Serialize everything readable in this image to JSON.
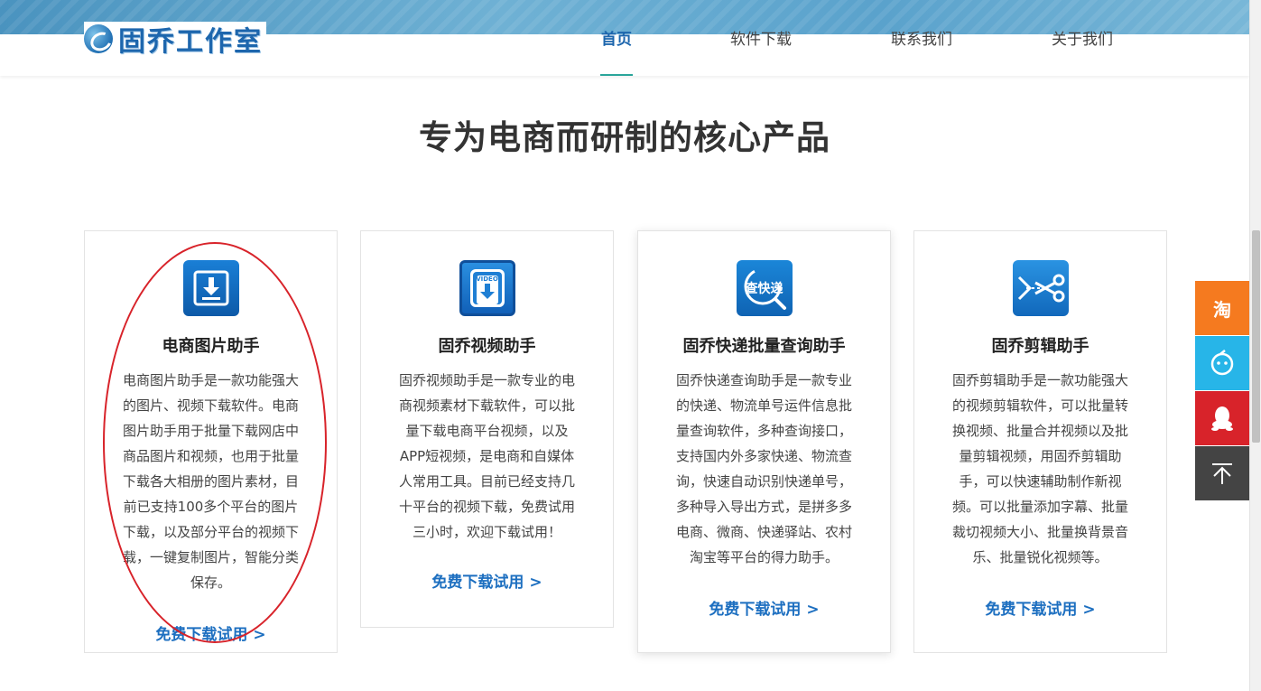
{
  "brand": {
    "name": "固乔工作室"
  },
  "nav": {
    "items": [
      {
        "label": "首页",
        "active": true
      },
      {
        "label": "软件下载",
        "active": false
      },
      {
        "label": "联系我们",
        "active": false
      },
      {
        "label": "关于我们",
        "active": false
      }
    ]
  },
  "section": {
    "title": "专为电商而研制的核心产品"
  },
  "products": [
    {
      "title": "电商图片助手",
      "icon": "download-icon",
      "description": "电商图片助手是一款功能强大的图片、视频下载软件。电商图片助手用于批量下载网店中商品图片和视频，也用于批量下载各大相册的图片素材，目前已支持100多个平台的图片下载，以及部分平台的视频下载，一键复制图片，智能分类保存。",
      "link": "免费下载试用 >"
    },
    {
      "title": "固乔视频助手",
      "icon": "video-download-icon",
      "icon_label": "VIDEO",
      "description": "固乔视频助手是一款专业的电商视频素材下载软件，可以批量下载电商平台视频，以及APP短视频，是电商和自媒体人常用工具。目前已经支持几十平台的视频下载，免费试用三小时，欢迎下载试用！",
      "link": "免费下载试用 >"
    },
    {
      "title": "固乔快递批量查询助手",
      "icon": "express-search-icon",
      "icon_label": "查快递",
      "description": "固乔快递查询助手是一款专业的快递、物流单号运件信息批量查询软件，多种查询接口，支持国内外多家快递、物流查询，快速自动识别快递单号，多种导入导出方式，是拼多多电商、微商、快递驿站、农村淘宝等平台的得力助手。",
      "link": "免费下载试用 >"
    },
    {
      "title": "固乔剪辑助手",
      "icon": "scissors-icon",
      "description": "固乔剪辑助手是一款功能强大的视频剪辑软件，可以批量转换视频、批量合并视频以及批量剪辑视频，用固乔剪辑助手，可以快速辅助制作新视频。可以批量添加字幕、批量裁切视频大小、批量换背景音乐、批量锐化视频等。",
      "link": "免费下载试用 >"
    }
  ],
  "side_panel": {
    "taobao": {
      "label": "淘",
      "color": "#f57a1f"
    },
    "chat": {
      "icon": "chat-bubble-icon",
      "color": "#27b5e8"
    },
    "qq": {
      "icon": "qq-penguin-icon",
      "color": "#d8232a"
    },
    "top": {
      "icon": "back-to-top-icon",
      "color": "#444444"
    }
  },
  "colors": {
    "accent": "#1d66ad",
    "link": "#1d6fc0",
    "nav_underline": "#2aa59a",
    "annotation": "#d8232a"
  }
}
